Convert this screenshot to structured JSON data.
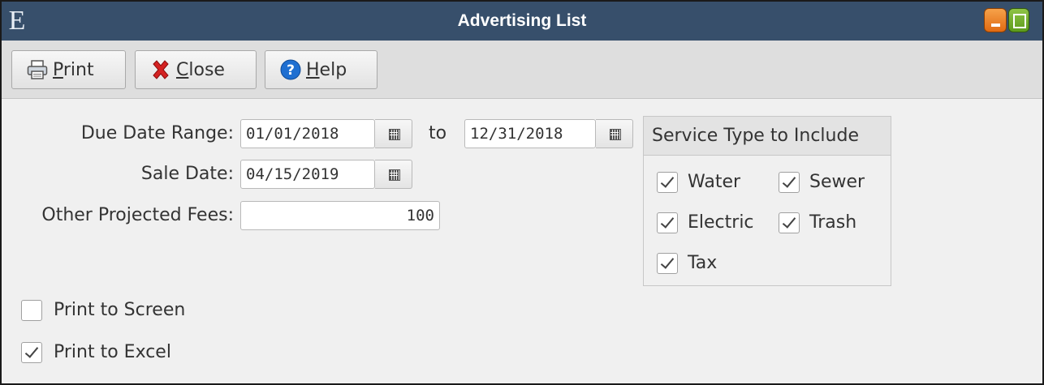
{
  "window": {
    "app_icon_letter": "E",
    "title": "Advertising List"
  },
  "toolbar": {
    "print": {
      "prefix": "",
      "accel": "P",
      "rest": "rint"
    },
    "close": {
      "prefix": "",
      "accel": "C",
      "rest": "lose"
    },
    "help": {
      "prefix": "",
      "accel": "H",
      "rest": "elp"
    }
  },
  "form": {
    "due_date_range_label": "Due Date Range:",
    "due_date_from": "01/01/2018",
    "to_label": "to",
    "due_date_to": "12/31/2018",
    "sale_date_label": "Sale Date:",
    "sale_date": "04/15/2019",
    "other_fees_label": "Other Projected Fees:",
    "other_fees": "100"
  },
  "service_types": {
    "header": "Service Type to Include",
    "water": {
      "label": "Water",
      "checked": true
    },
    "sewer": {
      "label": "Sewer",
      "checked": true
    },
    "electric": {
      "label": "Electric",
      "checked": true
    },
    "trash": {
      "label": "Trash",
      "checked": true
    },
    "tax": {
      "label": "Tax",
      "checked": true
    }
  },
  "output_options": {
    "print_to_screen": {
      "label": "Print to Screen",
      "checked": false
    },
    "print_to_excel": {
      "label": "Print to Excel",
      "checked": true
    }
  },
  "colors": {
    "titlebar": "#374f6b",
    "minimize": "#e88a2e",
    "maximize": "#6fad2a",
    "close_x": "#d42222",
    "help_blue": "#1f6fd1"
  },
  "icons": {
    "print": "printer-icon",
    "close": "red-x-icon",
    "help": "question-circle-icon",
    "calendar": "calendar-icon"
  }
}
